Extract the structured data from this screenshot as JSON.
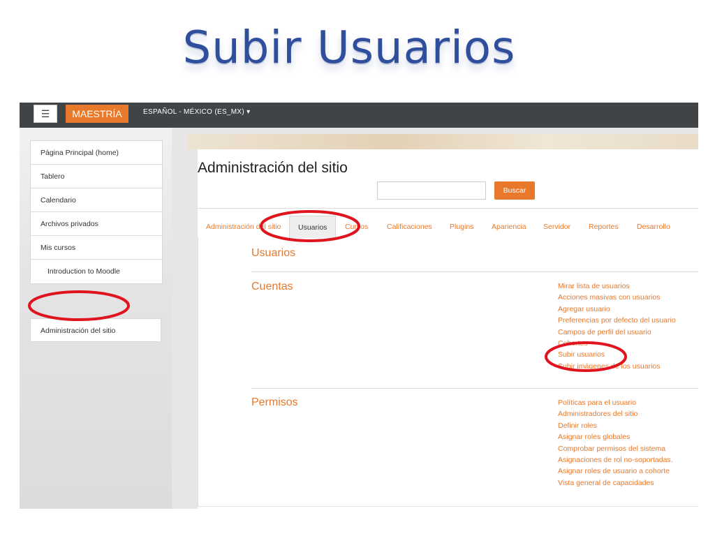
{
  "slide_title": "Subir Usuarios",
  "navbar": {
    "menu_icon": "hamburger-icon",
    "brand": "MAESTRÍA",
    "language": "ESPAÑOL - MÉXICO (ES_MX)",
    "language_caret": "▾"
  },
  "sidebar": {
    "items": [
      {
        "label": "Página Principal (home)"
      },
      {
        "label": "Tablero"
      },
      {
        "label": "Calendario"
      },
      {
        "label": "Archivos privados"
      },
      {
        "label": "Mis cursos"
      },
      {
        "label": "Introduction to Moodle"
      }
    ],
    "admin": "Administración del sitio"
  },
  "main": {
    "title": "Administración del sitio",
    "search": {
      "placeholder": "",
      "button": "Buscar"
    },
    "tabs": [
      {
        "label": "Administración del sitio"
      },
      {
        "label": "Usuarios"
      },
      {
        "label": "Cursos"
      },
      {
        "label": "Calificaciones"
      },
      {
        "label": "Plugins"
      },
      {
        "label": "Apariencia"
      },
      {
        "label": "Servidor"
      },
      {
        "label": "Reportes"
      },
      {
        "label": "Desarrollo"
      }
    ],
    "section_title": "Usuarios",
    "cuentas": {
      "title": "Cuentas",
      "links": [
        "Mirar lista de usuarios",
        "Acciones masivas con usuarios",
        "Agregar usuario",
        "Preferencias por defecto del usuario",
        "Campos de perfil del usuario",
        "Cohortes",
        "Subir usuarios",
        "Subir imágenes de los usuarios"
      ]
    },
    "permisos": {
      "title": "Permisos",
      "links": [
        "Políticas para el usuario",
        "Administradores del sitio",
        "Definir roles",
        "Asignar roles globales",
        "Comprobar permisos del sistema",
        "Asignaciones de rol no-soportadas.",
        "Asignar roles de usuario a cohorte",
        "Vista general de capacidades"
      ]
    }
  },
  "colors": {
    "accent": "#e8782a",
    "navbar": "#404446",
    "highlight": "#e0141e",
    "title": "#2f4e9c"
  }
}
